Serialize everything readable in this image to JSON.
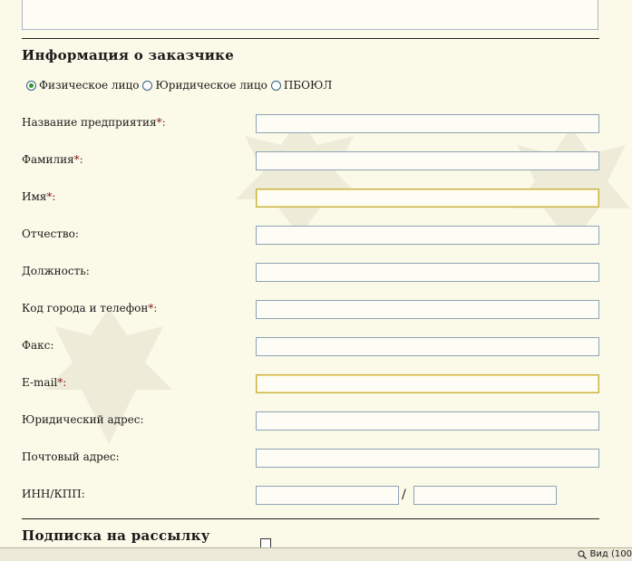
{
  "customer_section": {
    "title": "Информация о заказчике",
    "entity_type": {
      "options": [
        "Физическое лицо",
        "Юридическое лицо",
        "ПБОЮЛ"
      ],
      "selected": "Физическое лицо"
    },
    "fields": [
      {
        "label": "Название предприятия",
        "required_mark": "*",
        "suffix": ":",
        "value": ""
      },
      {
        "label": "Фамилия",
        "required_mark": "*",
        "suffix": ":",
        "value": ""
      },
      {
        "label": "Имя",
        "required_mark": "*",
        "suffix": ":",
        "value": ""
      },
      {
        "label": "Отчество",
        "required_mark": "",
        "suffix": ":",
        "value": ""
      },
      {
        "label": "Должность",
        "required_mark": "",
        "suffix": ":",
        "value": ""
      },
      {
        "label": "Код города и телефон",
        "required_mark": "*",
        "suffix": ":",
        "value": ""
      },
      {
        "label": "Факс",
        "required_mark": "",
        "suffix": ":",
        "value": ""
      },
      {
        "label": "E-mail",
        "required_mark": "*",
        "suffix": ":",
        "value": ""
      },
      {
        "label": "Юридический адрес",
        "required_mark": "",
        "suffix": ":",
        "value": ""
      },
      {
        "label": "Почтовый адрес",
        "required_mark": "",
        "suffix": ":",
        "value": ""
      }
    ],
    "inn_kpp": {
      "label": "ИНН/КПП:",
      "separator": "/",
      "inn_value": "",
      "kpp_value": ""
    }
  },
  "subscription_section": {
    "title": "Подписка на рассылку"
  },
  "statusbar": {
    "zoom_text": "Вид (100",
    "icon": "magnifier-icon"
  },
  "colors": {
    "background": "#fbf9e8",
    "required": "#8b1a1a",
    "radio_dot": "#2d9a2d",
    "field_border": "#8ea3b6",
    "focus_border": "#c5b04a"
  }
}
